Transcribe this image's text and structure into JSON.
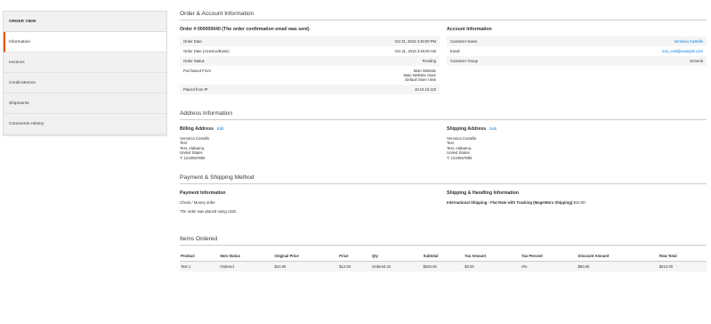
{
  "sidebar": {
    "title": "ORDER VIEW",
    "items": [
      {
        "label": "Information"
      },
      {
        "label": "Invoices"
      },
      {
        "label": "Credit Memos"
      },
      {
        "label": "Shipments"
      },
      {
        "label": "Comments History"
      }
    ]
  },
  "order_account": {
    "section_title": "Order & Account Information",
    "order_title": "Order # 000000040 (The order confirmation email was sent)",
    "rows": [
      {
        "label": "Order Date",
        "value": "Oct 31, 2016 3:49:00 PM"
      },
      {
        "label": "Order Date (America/Boise)",
        "value": "Oct 31, 2016 3:49:00 AM"
      },
      {
        "label": "Order Status",
        "value": "Pending"
      },
      {
        "label": "Purchased From",
        "value_lines": [
          "Main Website",
          "Main Website Store",
          "Default Store View"
        ]
      },
      {
        "label": "Placed from IP",
        "value": "10.10.10.110"
      }
    ],
    "account_title": "Account Information",
    "account_rows": [
      {
        "label": "Customer Name",
        "value": "Veronica Costello"
      },
      {
        "label": "Email",
        "value": "roni_cost@example.com"
      },
      {
        "label": "Customer Group",
        "value": "General"
      }
    ]
  },
  "address": {
    "section_title": "Address Information",
    "billing_title": "Billing Address",
    "shipping_title": "Shipping Address",
    "edit_label": "Edit",
    "billing_lines": [
      "Veronica Costello",
      "Test",
      "Test, Alabama,",
      "United States",
      "T: 1234567890"
    ],
    "shipping_lines": [
      "Veronica Costello",
      "Test",
      "Test, Alabama,",
      "United States",
      "T: 1234567890"
    ]
  },
  "payment_shipping": {
    "section_title": "Payment & Shipping Method",
    "payment_title": "Payment Information",
    "payment_method": "Check / Money order",
    "currency_note": "The order was placed using USD.",
    "shipping_title": "Shipping & Handling Information",
    "shipping_method": "International Shipping - Flat Rate with Tracking (MageWorx Shipping)",
    "shipping_price": "$10.00"
  },
  "items": {
    "section_title": "Items Ordered",
    "headers": [
      "Product",
      "Item Status",
      "Original Price",
      "Price",
      "Qty",
      "Subtotal",
      "Tax Amount",
      "Tax Percent",
      "Discount Amount",
      "Row Total"
    ],
    "rows": [
      [
        "Test 1",
        "Ordered",
        "$10.00",
        "$12.00",
        "Ordered 22",
        "$264.00",
        "$0.00",
        "0%",
        "$50.00",
        "$214.00"
      ]
    ]
  },
  "colors": {
    "accent": "#eb5202",
    "link": "#007bdb",
    "sidebar_bg": "#f1f1f1",
    "row_stripe": "#f5f5f5"
  }
}
